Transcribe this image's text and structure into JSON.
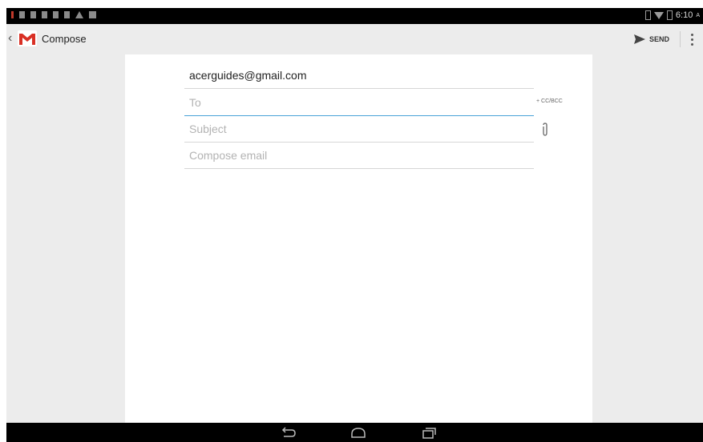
{
  "status_bar": {
    "time": "6:10",
    "time_suffix": "A"
  },
  "action_bar": {
    "title": "Compose",
    "send_label": "SEND"
  },
  "compose": {
    "from_value": "acerguides@gmail.com",
    "to_placeholder": "To",
    "subject_placeholder": "Subject",
    "body_placeholder": "Compose email",
    "cc_bcc_label": "+ CC/BCC"
  },
  "icons": {
    "back": "chevron-left-icon",
    "logo": "gmail-logo-icon",
    "send": "send-icon",
    "menu": "overflow-menu-icon",
    "attach": "paperclip-icon",
    "nav_back": "back-arrow-icon",
    "nav_home": "home-icon",
    "nav_recents": "recents-icon"
  },
  "colors": {
    "accent": "#4aa3d8",
    "gmail_red": "#d93025",
    "background": "#ececec"
  }
}
